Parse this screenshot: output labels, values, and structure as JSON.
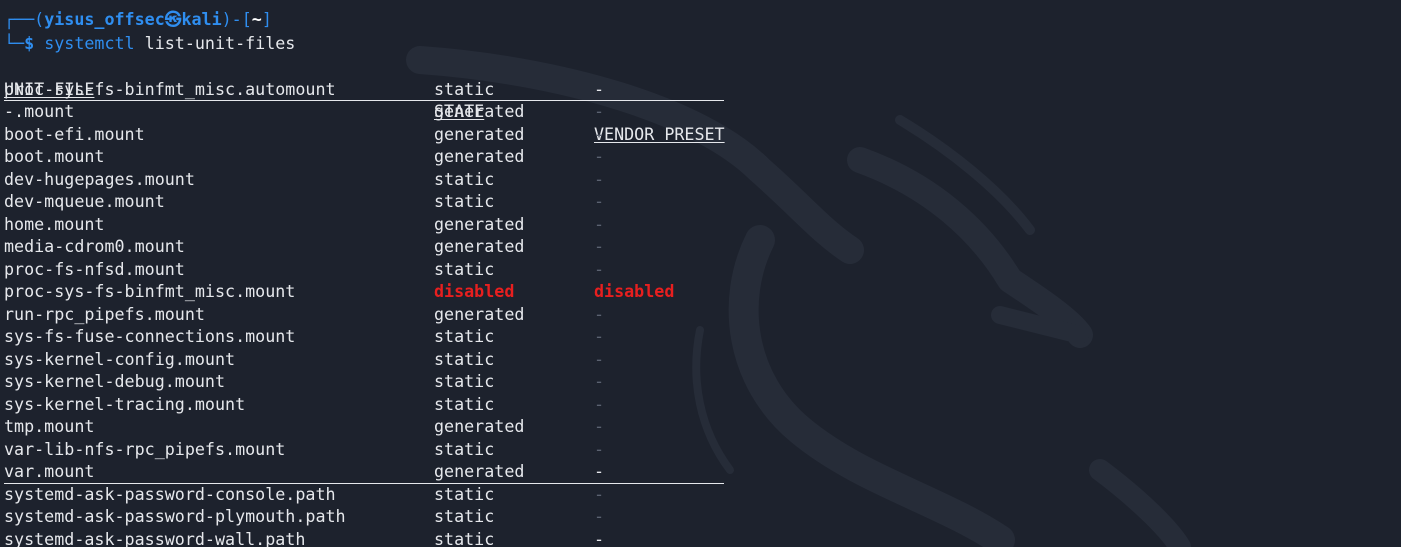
{
  "prompt": {
    "frame_top": "┌──(",
    "user": "yisus_offsec",
    "at": "㉿",
    "host": "kali",
    "mid": ")-[",
    "dir": "~",
    "end": "]",
    "frame_bottom": "└─",
    "dollar": "$ ",
    "command": "systemctl",
    "args": " list-unit-files"
  },
  "table": {
    "headers": {
      "unit": "UNIT FILE",
      "state": "STATE",
      "preset": "VENDOR PRESET"
    },
    "rows": [
      {
        "unit": "proc-sys-fs-binfmt_misc.automount",
        "state": "static",
        "preset": "-",
        "underline": true
      },
      {
        "unit": "-.mount",
        "state": "generated",
        "preset": "-"
      },
      {
        "unit": "boot-efi.mount",
        "state": "generated",
        "preset": "-"
      },
      {
        "unit": "boot.mount",
        "state": "generated",
        "preset": "-"
      },
      {
        "unit": "dev-hugepages.mount",
        "state": "static",
        "preset": "-"
      },
      {
        "unit": "dev-mqueue.mount",
        "state": "static",
        "preset": "-"
      },
      {
        "unit": "home.mount",
        "state": "generated",
        "preset": "-"
      },
      {
        "unit": "media-cdrom0.mount",
        "state": "generated",
        "preset": "-"
      },
      {
        "unit": "proc-fs-nfsd.mount",
        "state": "static",
        "preset": "-"
      },
      {
        "unit": "proc-sys-fs-binfmt_misc.mount",
        "state": "disabled",
        "preset": "disabled",
        "alert": true
      },
      {
        "unit": "run-rpc_pipefs.mount",
        "state": "generated",
        "preset": "-"
      },
      {
        "unit": "sys-fs-fuse-connections.mount",
        "state": "static",
        "preset": "-"
      },
      {
        "unit": "sys-kernel-config.mount",
        "state": "static",
        "preset": "-"
      },
      {
        "unit": "sys-kernel-debug.mount",
        "state": "static",
        "preset": "-"
      },
      {
        "unit": "sys-kernel-tracing.mount",
        "state": "static",
        "preset": "-"
      },
      {
        "unit": "tmp.mount",
        "state": "generated",
        "preset": "-"
      },
      {
        "unit": "var-lib-nfs-rpc_pipefs.mount",
        "state": "static",
        "preset": "-"
      },
      {
        "unit": "var.mount",
        "state": "generated",
        "preset": "-",
        "underline": true
      },
      {
        "unit": "systemd-ask-password-console.path",
        "state": "static",
        "preset": "-"
      },
      {
        "unit": "systemd-ask-password-plymouth.path",
        "state": "static",
        "preset": "-"
      },
      {
        "unit": "systemd-ask-password-wall.path",
        "state": "static",
        "preset": "-",
        "underline": true
      }
    ]
  },
  "colors": {
    "background": "#1d222d",
    "prompt_blue": "#2f8ef0",
    "text": "#e6e8ec",
    "alert_red": "#e81f1f",
    "dim_dash": "#5b6270"
  },
  "background_icon": "kali-dragon-icon"
}
